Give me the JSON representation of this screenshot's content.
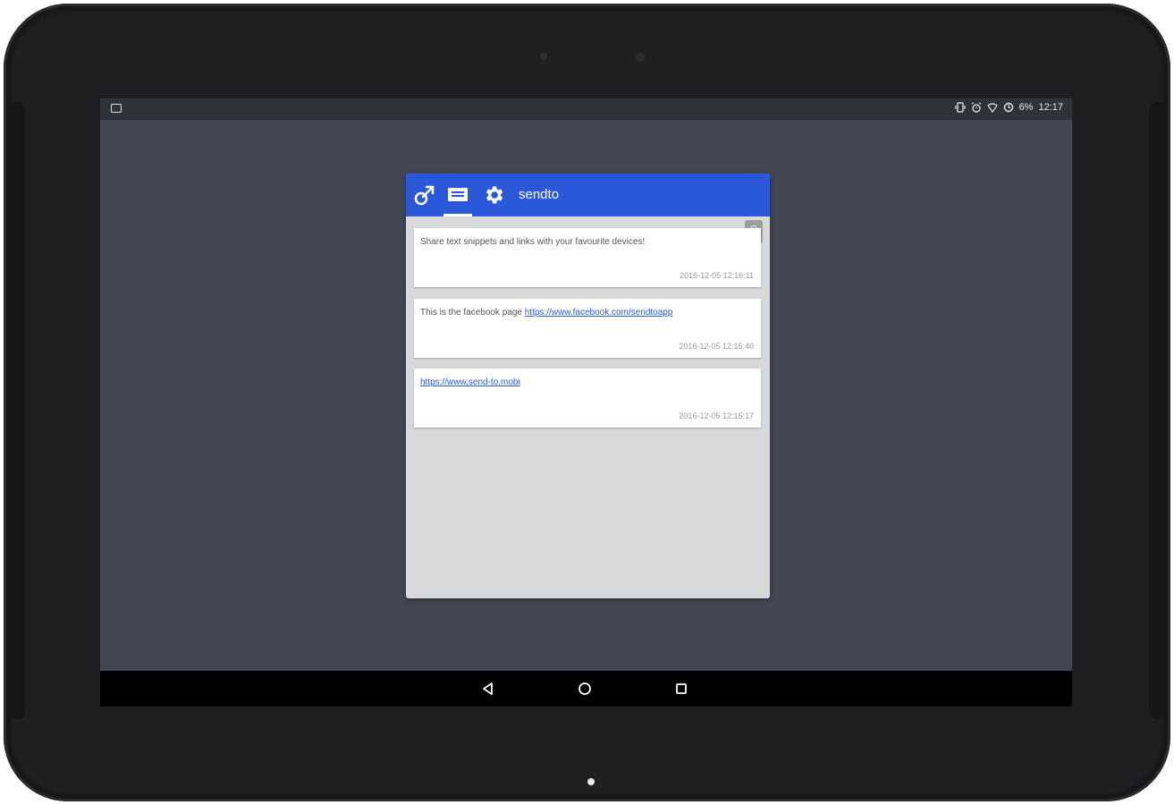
{
  "status_bar": {
    "battery": "6%",
    "time": "12:17"
  },
  "app": {
    "title": "sendto",
    "tabs": [
      {
        "name": "share",
        "icon": "send-icon"
      },
      {
        "name": "messages",
        "icon": "message-icon",
        "selected": true
      },
      {
        "name": "settings",
        "icon": "gear-icon"
      }
    ],
    "accent_color": "#2b57d9"
  },
  "messages": [
    {
      "text": "Share text snippets and links with your favourite devices!",
      "link": "",
      "timestamp": "2016-12-05 12:16:11"
    },
    {
      "text": "This is the facebook page ",
      "link": "https://www.facebook.com/sendtoapp",
      "timestamp": "2016-12-05 12:15:40"
    },
    {
      "text": "",
      "link": "https://www.send-to.mobi",
      "timestamp": "2016-12-05 12:15:17"
    }
  ]
}
